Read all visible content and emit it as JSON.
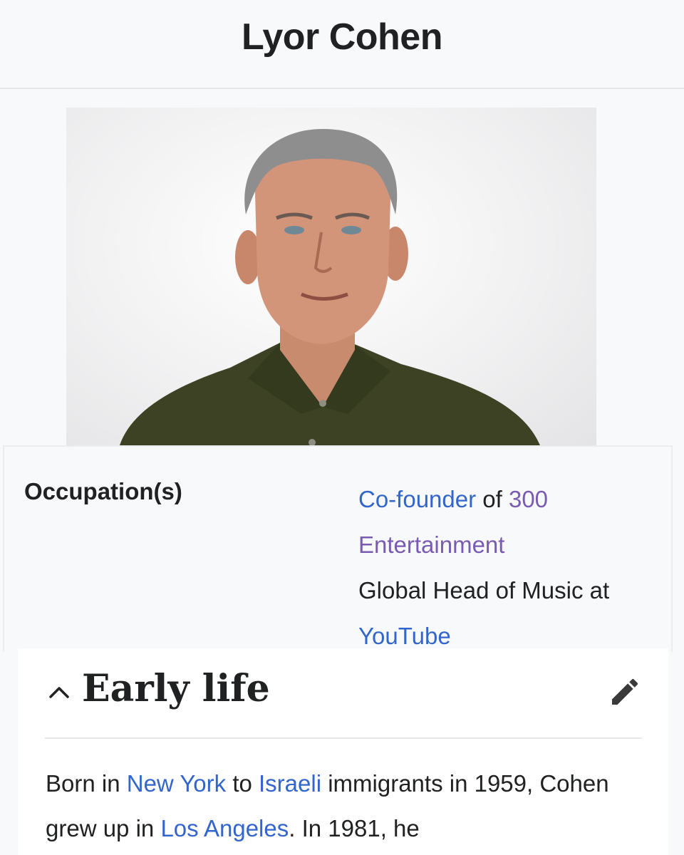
{
  "page": {
    "title": "Lyor Cohen"
  },
  "infobox": {
    "image_alt": "Lyor Cohen portrait",
    "occupation_label": "Occupation(s)",
    "occupation": {
      "cofounder_link": "Co-founder",
      "of_text": " of ",
      "company_link": "300 Entertainment",
      "role_text": "Global Head of Music at ",
      "youtube_link": "YouTube"
    }
  },
  "section": {
    "title": "Early life",
    "collapse_icon": "chevron-up-icon",
    "edit_icon": "pencil-icon",
    "body": {
      "t1": "Born in ",
      "link1": "New York",
      "t2": " to ",
      "link2": "Israeli",
      "t3": " immigrants in 1959, Cohen grew up in ",
      "link3": "Los Angeles",
      "t4": ". In 1981, he"
    }
  },
  "colors": {
    "link": "#3366cc",
    "visited_link": "#795cb2",
    "text": "#202122",
    "background": "#f8f9fa"
  }
}
